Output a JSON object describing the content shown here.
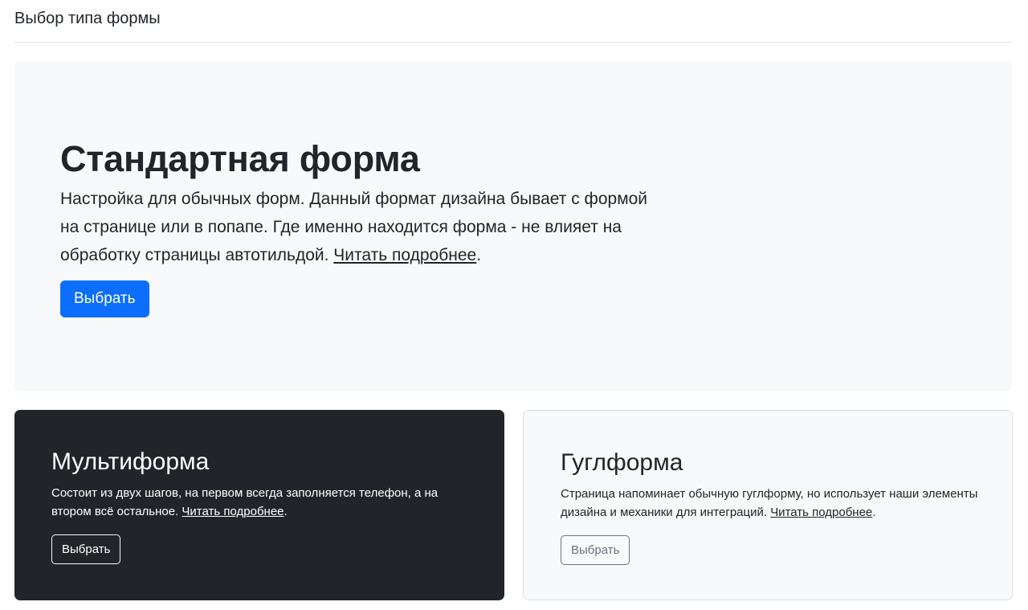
{
  "header": {
    "title": "Выбор типа формы"
  },
  "hero": {
    "title": "Стандартная форма",
    "text": "Настройка для обычных форм. Данный формат дизайна бывает с формой на странице или в попапе. Где именно находится форма - не влияет на обработку страницы автотильдой. ",
    "link_label": "Читать подробнее",
    "text_end": ".",
    "button_label": "Выбрать"
  },
  "cards": [
    {
      "title": "Мультиформа",
      "text": "Состоит из двух шагов, на первом всегда заполняется телефон, а на втором всё остальное. ",
      "link_label": "Читать подробнее",
      "text_end": ".",
      "button_label": "Выбрать"
    },
    {
      "title": "Гуглформа",
      "text": "Страница напоминает обычную гуглформу, но использует наши элементы дизайна и механики для интеграций. ",
      "link_label": "Читать подробнее",
      "text_end": ".",
      "button_label": "Выбрать"
    }
  ],
  "colors": {
    "primary": "#0d6efd",
    "dark_card": "#212529",
    "light_bg": "#f8f9fa",
    "border": "#dee2e6",
    "secondary": "#6c757d"
  }
}
